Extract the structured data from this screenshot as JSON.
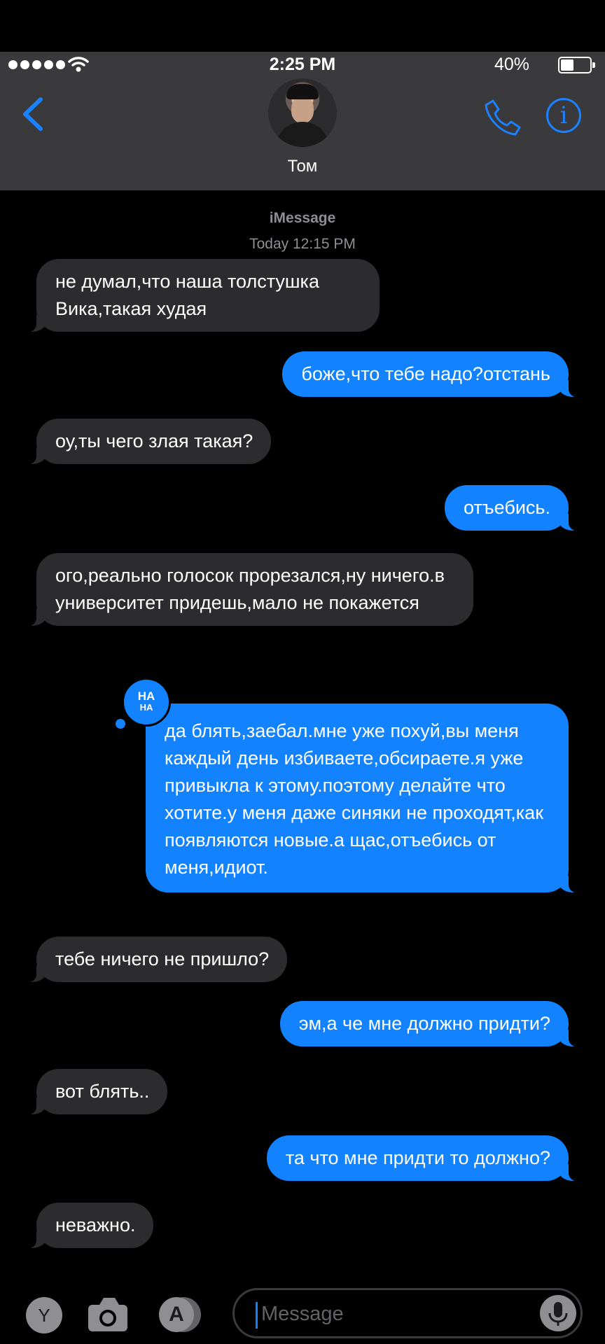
{
  "status_bar": {
    "time": "2:25 PM",
    "battery_percent": "40%",
    "battery_level": 0.4
  },
  "header": {
    "contact_name": "Том",
    "back_icon": "chevron-left-icon",
    "phone_icon": "phone-icon",
    "info_icon": "info-icon",
    "accent_color": "#1a82ff"
  },
  "thread": {
    "service": "iMessage",
    "timestamp": "Today 12:15 PM"
  },
  "messages": [
    {
      "side": "in",
      "text": "не думал,что наша толстушка Вика,такая худая"
    },
    {
      "side": "out",
      "text": "боже,что тебе надо?отстань"
    },
    {
      "side": "in",
      "text": "оу,ты чего злая такая?"
    },
    {
      "side": "out",
      "text": "отъебись."
    },
    {
      "side": "in",
      "text": "ого,реально голосок прорезался,ну ничего.в университет придешь,мало не покажется"
    },
    {
      "side": "out",
      "text": "да блять,заебал.мне уже похуй,вы меня каждый день избиваете,обсираете.я уже привыкла к этому.поэтому делайте что хотите.у меня даже синяки не проходят,как появляются новые.а щас,отъебись от меня,идиот.",
      "tapback": {
        "line1": "HA",
        "line2": "HA"
      }
    },
    {
      "side": "in",
      "text": "тебе ничего не пришло?"
    },
    {
      "side": "out",
      "text": "эм,а че мне должно придти?"
    },
    {
      "side": "in",
      "text": "вот блять.."
    },
    {
      "side": "out",
      "text": "та что мне придти то должно?"
    },
    {
      "side": "in",
      "text": "неважно."
    }
  ],
  "composer": {
    "placeholder": "Message",
    "app_button_label": "Y",
    "icons": [
      "camera-icon",
      "app-store-icon",
      "microphone-icon"
    ]
  },
  "colors": {
    "incoming_bubble": "#2c2c2e",
    "outgoing_bubble": "#1382fe",
    "background": "#000000",
    "header_bg": "#3a3a3c"
  }
}
